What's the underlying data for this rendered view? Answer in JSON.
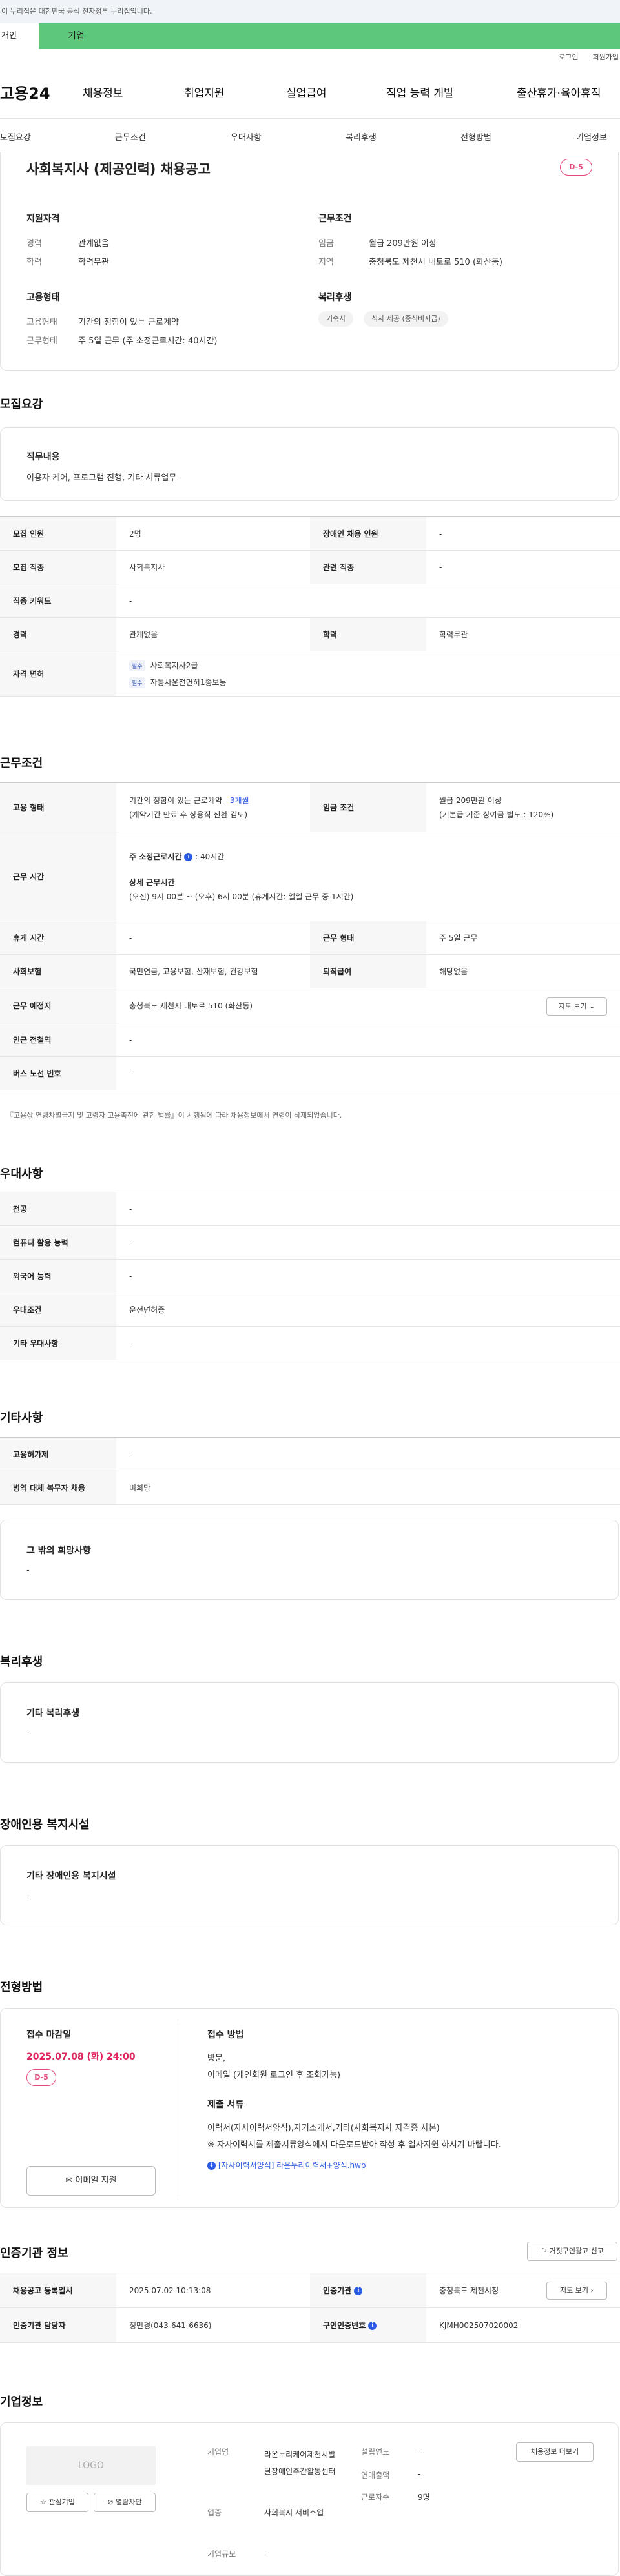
{
  "banner": "이 누리집은 대한민국 공식 전자정부 누리집입니다.",
  "tabs": {
    "personal": "개인",
    "company": "기업"
  },
  "util": {
    "login": "로그인",
    "signup": "회원가입"
  },
  "gnb": {
    "logo": "고용24",
    "items": [
      "채용정보",
      "취업지원",
      "실업급여",
      "직업 능력 개발",
      "출산휴가·육아휴직"
    ]
  },
  "subnav": [
    "모집요강",
    "근무조건",
    "우대사항",
    "복리후생",
    "전형방법",
    "기업정보"
  ],
  "summary": {
    "title": "사회복지사 (제공인력) 채용공고",
    "dday": "D-5",
    "qual": {
      "title": "지원자격",
      "rows": [
        {
          "k": "경력",
          "v": "관계없음"
        },
        {
          "k": "학력",
          "v": "학력무관"
        }
      ]
    },
    "work": {
      "title": "근무조건",
      "rows": [
        {
          "k": "임금",
          "v": "월급 209만원 이상"
        },
        {
          "k": "지역",
          "v": "충청북도 제천시 내토로 510 (화산동)"
        }
      ]
    },
    "emp": {
      "title": "고용형태",
      "rows": [
        {
          "k": "고용형태",
          "v": "기간의 정함이 있는 근로계약"
        },
        {
          "k": "근무형태",
          "v": "주 5일 근무 (주 소정근로시간: 40시간)"
        }
      ]
    },
    "welfare": {
      "title": "복리후생",
      "chips": [
        "기숙사",
        "식사 제공 (중식비지급)"
      ]
    }
  },
  "recruit": {
    "title": "모집요강",
    "duty_title": "직무내용",
    "duty": "이용자 케어,  프로그램 진행, 기타 서류업무",
    "rows": {
      "people_k": "모집 인원",
      "people_v": "2명",
      "dis_k": "장애인 채용 인원",
      "dis_v": "-",
      "job_k": "모집 직종",
      "job_v": "사회복지사",
      "rel_k": "관련 직종",
      "rel_v": "-",
      "kw_k": "직종 키워드",
      "kw_v": "-",
      "career_k": "경력",
      "career_v": "관계없음",
      "edu_k": "학력",
      "edu_v": "학력무관",
      "lic_k": "자격 면허",
      "lic_badge": "필수",
      "lic1": "사회복지사2급",
      "lic2": "자동차운전면허1종보통"
    }
  },
  "cond": {
    "title": "근무조건",
    "type_k": "고용 형태",
    "type_v1": "기간의 정함이 있는 근로계약 - ",
    "type_link": "3개월",
    "type_v2": "(계약기간 만료 후 상용직 전환 검토)",
    "wage_k": "임금 조건",
    "wage_v1": "월급 209만원 이상",
    "wage_v2": "(기본급 기준 상여금 별도 : 120%)",
    "time_k": "근무 시간",
    "time_h1": "주 소정근로시간",
    "time_v1": ": 40시간",
    "time_h2": "상세 근무시간",
    "time_v2": "(오전) 9시 00분 ~ (오후) 6시 00분 (휴게시간: 일일 근무 중 1시간)",
    "rest_k": "휴게 시간",
    "rest_v": "-",
    "form_k": "근무 형태",
    "form_v": "주 5일 근무",
    "ins_k": "사회보험",
    "ins_v": "국민연금, 고용보험, 산재보험, 건강보험",
    "ret_k": "퇴직급여",
    "ret_v": "해당없음",
    "place_k": "근무 예정지",
    "place_v": "충청북도 제천시 내토로 510 (화산동)",
    "map_btn": "지도 보기",
    "sub_k": "인근 전철역",
    "sub_v": "-",
    "bus_k": "버스 노선 번호",
    "bus_v": "-",
    "note": "『고용상 연령차별금지 및 고령자 고용촉진에 관한 법률』이 시행됨에 따라 채용정보에서 연령이 삭제되었습니다."
  },
  "pref": {
    "title": "우대사항",
    "rows": [
      {
        "k": "전공",
        "v": "-"
      },
      {
        "k": "컴퓨터 활용 능력",
        "v": "-"
      },
      {
        "k": "외국어 능력",
        "v": "-"
      },
      {
        "k": "우대조건",
        "v": "운전면허증"
      },
      {
        "k": "기타 우대사항",
        "v": "-"
      }
    ]
  },
  "etc": {
    "title": "기타사항",
    "rows": [
      {
        "k": "고용허가제",
        "v": "-"
      },
      {
        "k": "병역 대체 복무자 채용",
        "v": "비희망"
      }
    ],
    "box_title": "그 밖의 희망사항",
    "box_v": "-"
  },
  "welfare": {
    "title": "복리후생",
    "box_title": "기타 복리후생",
    "box_v": "-"
  },
  "dis": {
    "title": "장애인용 복지시설",
    "box_title": "기타 장애인용 복지시설",
    "box_v": "-"
  },
  "process": {
    "title": "전형방법",
    "deadline_t": "접수 마감일",
    "deadline": "2025.07.08 (화) 24:00",
    "dday": "D-5",
    "email_btn": "이메일 지원",
    "method_t": "접수 방법",
    "method1": "방문,",
    "method2": "이메일 (개인회원 로그인 후 조회가능)",
    "docs_t": "제출 서류",
    "docs1": "이력서(자사이력서양식),자기소개서,기타(사회복지사 자격증 사본)",
    "docs2": "※ 자사이력서를 제출서류양식에서 다운로드받아 작성 후 입사지원 하시기 바랍니다.",
    "file": "[자사이력서양식] 라온누리이력서+양식.hwp"
  },
  "cert": {
    "title": "인증기관 정보",
    "report_btn": "거짓구인광고 신고",
    "reg_k": "채용공고 등록일시",
    "reg_v": "2025.07.02 10:13:08",
    "org_k": "인증기관",
    "org_v": "충청북도 제천시청",
    "map_btn": "지도 보기",
    "mgr_k": "인증기관 담당자",
    "mgr_v": "정민경(043-641-6636)",
    "num_k": "구인인증번호",
    "num_v": "KJMH002507020002"
  },
  "company": {
    "title": "기업정보",
    "logo": "LOGO",
    "fav_btn": "관심기업",
    "block_btn": "열람차단",
    "name_k": "기업명",
    "name_v": "라온누리케어제천시발달장애인주간활동센터",
    "ind_k": "업종",
    "ind_v": "사회복지 서비스업",
    "size_k": "기업규모",
    "size_v": "-",
    "year_k": "설립연도",
    "year_v": "-",
    "sales_k": "연매출액",
    "sales_v": "-",
    "emp_k": "근로자수",
    "emp_v": "9명",
    "more_btn": "채용정보 더보기"
  }
}
